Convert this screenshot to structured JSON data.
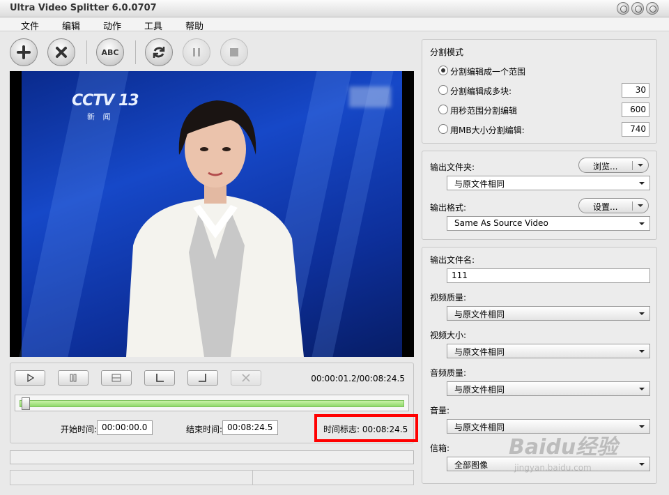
{
  "window": {
    "title": "Ultra Video Splitter 6.0.0707"
  },
  "menu": [
    "文件",
    "编辑",
    "动作",
    "工具",
    "帮助"
  ],
  "toolbar": {
    "buttons": [
      "add-icon",
      "remove-icon",
      "rename-icon",
      "split-icon",
      "pause-icon",
      "stop-icon"
    ],
    "rename_label": "ABC"
  },
  "video": {
    "logo": "CCTV 13",
    "logo_sub": "新 闻"
  },
  "player": {
    "timecode": "00:00:01.2/00:08:24.5",
    "position_fraction": 0.002
  },
  "times": {
    "start_label": "开始时间:",
    "start_value": "00:00:00.0",
    "end_label": "结束时间:",
    "end_value": "00:08:24.5",
    "mark_label": "时间标志:",
    "mark_value": "00:08:24.5"
  },
  "split_mode": {
    "title": "分割模式",
    "opt1": "分割编辑成一个范围",
    "opt2": "分割编辑成多块:",
    "opt2_value": "30",
    "opt3": "用秒范围分割编辑",
    "opt3_value": "600",
    "opt4": "用MB大小分割编辑:",
    "opt4_value": "740"
  },
  "output": {
    "folder_label": "输出文件夹:",
    "browse": "浏览...",
    "folder_value": "与原文件相同",
    "format_label": "输出格式:",
    "settings": "设置...",
    "format_value": "Same As Source Video"
  },
  "options": {
    "filename_label": "输出文件名:",
    "filename_value": "111",
    "vq_label": "视频质量:",
    "vq_value": "与原文件相同",
    "vs_label": "视频大小:",
    "vs_value": "与原文件相同",
    "aq_label": "音频质量:",
    "aq_value": "与原文件相同",
    "vol_label": "音量:",
    "vol_value": "与原文件相同",
    "ch_label": "信箱:",
    "ch_value": "全部图像"
  },
  "watermark": {
    "brand": "Baidu经验",
    "url": "jingyan.baidu.com"
  },
  "colors": {
    "highlight": "#ff0000",
    "progress": "#8fd86a"
  }
}
